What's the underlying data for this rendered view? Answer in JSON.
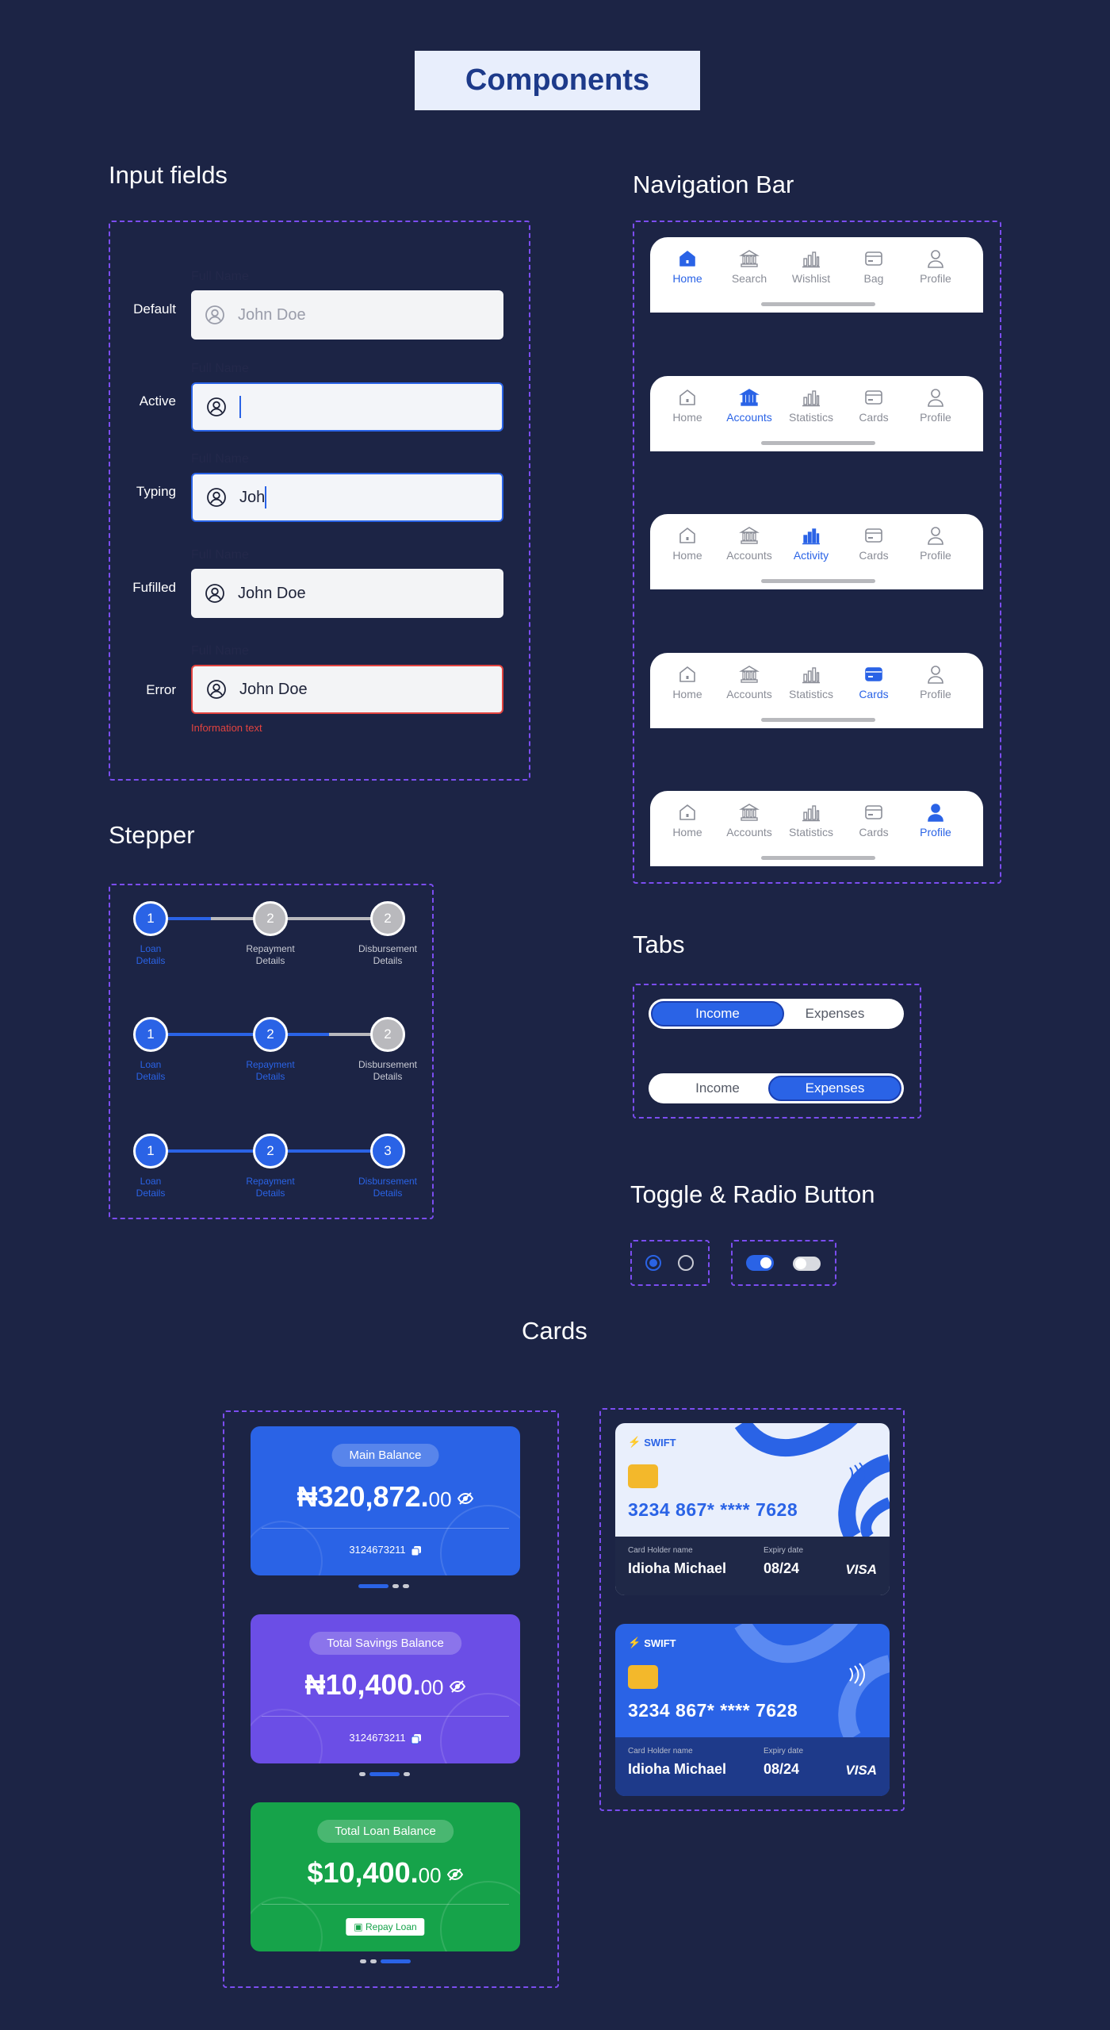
{
  "title": "Components",
  "sections": {
    "inputs": "Input fields",
    "nav": "Navigation Bar",
    "stepper": "Stepper",
    "tabs": "Tabs",
    "toggle": "Toggle &  Radio Button",
    "cards": "Cards"
  },
  "inputs": [
    {
      "state": "Default",
      "caption": "Full Name",
      "value": "John Doe"
    },
    {
      "state": "Active",
      "caption": "Full Name",
      "value": ""
    },
    {
      "state": "Typing",
      "caption": "Full Name",
      "value": "Joh"
    },
    {
      "state": "Fufilled",
      "caption": "Full Name",
      "value": "John Doe"
    },
    {
      "state": "Error",
      "caption": "Full Name",
      "value": "John Doe",
      "error": "Information text"
    }
  ],
  "navbars": [
    {
      "items": [
        "Home",
        "Search",
        "Wishlist",
        "Bag",
        "Profile"
      ],
      "selected": 0
    },
    {
      "items": [
        "Home",
        "Accounts",
        "Statistics",
        "Cards",
        "Profile"
      ],
      "selected": 1
    },
    {
      "items": [
        "Home",
        "Accounts",
        "Activity",
        "Cards",
        "Profile"
      ],
      "selected": 2
    },
    {
      "items": [
        "Home",
        "Accounts",
        "Statistics",
        "Cards",
        "Profile"
      ],
      "selected": 3
    },
    {
      "items": [
        "Home",
        "Accounts",
        "Statistics",
        "Cards",
        "Profile"
      ],
      "selected": 4
    }
  ],
  "stepper": [
    {
      "nums": [
        "1",
        "2",
        "2"
      ],
      "active": 1,
      "labels": [
        [
          "Loan",
          "Details"
        ],
        [
          "Repayment",
          "Details"
        ],
        [
          "Disbursement",
          "Details"
        ]
      ]
    },
    {
      "nums": [
        "1",
        "2",
        "2"
      ],
      "active": 2,
      "labels": [
        [
          "Loan",
          "Details"
        ],
        [
          "Repayment",
          "Details"
        ],
        [
          "Disbursement",
          "Details"
        ]
      ]
    },
    {
      "nums": [
        "1",
        "2",
        "3"
      ],
      "active": 3,
      "labels": [
        [
          "Loan",
          "Details"
        ],
        [
          "Repayment",
          "Details"
        ],
        [
          "Disbursement",
          "Details"
        ]
      ]
    }
  ],
  "tabs": [
    {
      "items": [
        "Income",
        "Expenses"
      ],
      "selected": 0
    },
    {
      "items": [
        "Income",
        "Expenses"
      ],
      "selected": 1
    }
  ],
  "balance_cards": [
    {
      "label": "Main Balance",
      "amount": "₦320,872.",
      "cents": "00",
      "account": "3124673211",
      "color": "#2a63e6"
    },
    {
      "label": "Total Savings Balance",
      "amount": "₦10,400.",
      "cents": "00",
      "account": "3124673211",
      "color": "#6b4ee6"
    },
    {
      "label": "Total Loan Balance",
      "amount": "$10,400.",
      "cents": "00",
      "button": "Repay Loan",
      "color": "#16a34a"
    }
  ],
  "credit_cards": [
    {
      "brand": "SWIFT",
      "number": "3234 867* **** 7628",
      "holder_label": "Card Holder name",
      "holder": "Idioha Michael",
      "expiry_label": "Expiry date",
      "expiry": "08/24",
      "network": "VISA"
    },
    {
      "brand": "SWIFT",
      "number": "3234 867* **** 7628",
      "holder_label": "Card Holder name",
      "holder": "Idioha Michael",
      "expiry_label": "Expiry date",
      "expiry": "08/24",
      "network": "VISA"
    }
  ],
  "colors": {
    "accent": "#2a63e6",
    "background": "#1c2445",
    "error": "#e2433f",
    "dashed": "#7b4df0"
  }
}
